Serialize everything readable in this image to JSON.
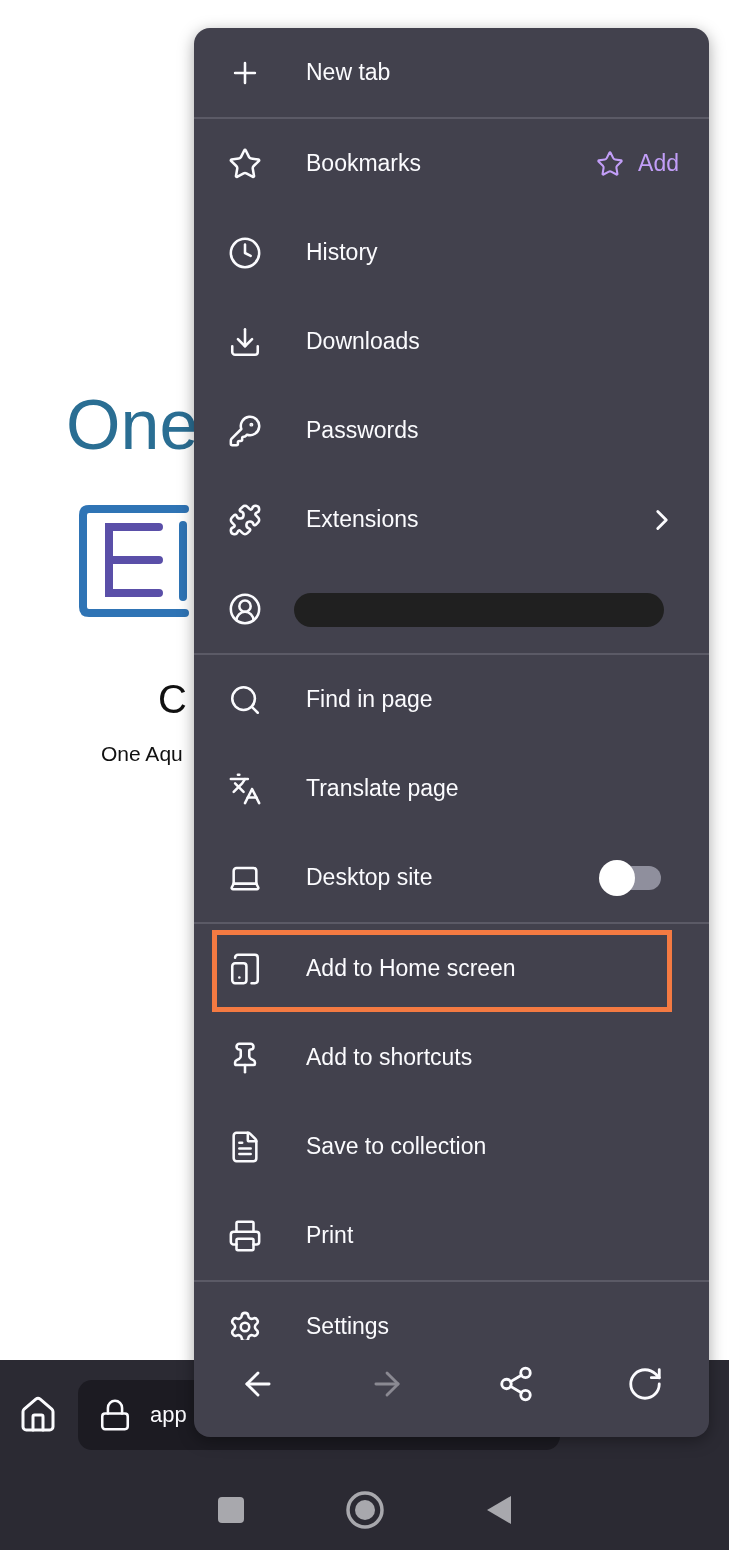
{
  "page": {
    "heading": "One",
    "subheading": "C",
    "text": "One Aqu"
  },
  "toolbar": {
    "url": "app"
  },
  "menu": {
    "sections": [
      {
        "items": [
          {
            "kind": "plain",
            "label": "New tab",
            "highlighted": false
          }
        ]
      },
      {
        "items": [
          {
            "kind": "bookmark",
            "label": "Bookmarks",
            "action": "Add",
            "highlighted": false
          },
          {
            "kind": "plain",
            "label": "History",
            "highlighted": false
          },
          {
            "kind": "plain",
            "label": "Downloads",
            "highlighted": false
          },
          {
            "kind": "plain",
            "label": "Passwords",
            "highlighted": false
          },
          {
            "kind": "submenu",
            "label": "Extensions",
            "highlighted": false
          },
          {
            "kind": "account",
            "redacted": true,
            "highlighted": false
          }
        ]
      },
      {
        "items": [
          {
            "kind": "plain",
            "label": "Find in page",
            "highlighted": false
          },
          {
            "kind": "plain",
            "label": "Translate page",
            "highlighted": false
          },
          {
            "kind": "toggle",
            "label": "Desktop site",
            "on": false,
            "highlighted": false
          }
        ]
      },
      {
        "items": [
          {
            "kind": "plain",
            "label": "Add to Home screen",
            "highlighted": true
          },
          {
            "kind": "plain",
            "label": "Add to shortcuts",
            "highlighted": false
          },
          {
            "kind": "plain",
            "label": "Save to collection",
            "highlighted": false
          },
          {
            "kind": "plain",
            "label": "Print",
            "highlighted": false
          }
        ]
      },
      {
        "items": [
          {
            "kind": "plain",
            "label": "Settings",
            "highlighted": false
          }
        ]
      }
    ],
    "nav_buttons": [
      {
        "disabled": false
      },
      {
        "disabled": true
      },
      {
        "disabled": false
      },
      {
        "disabled": false
      }
    ]
  }
}
